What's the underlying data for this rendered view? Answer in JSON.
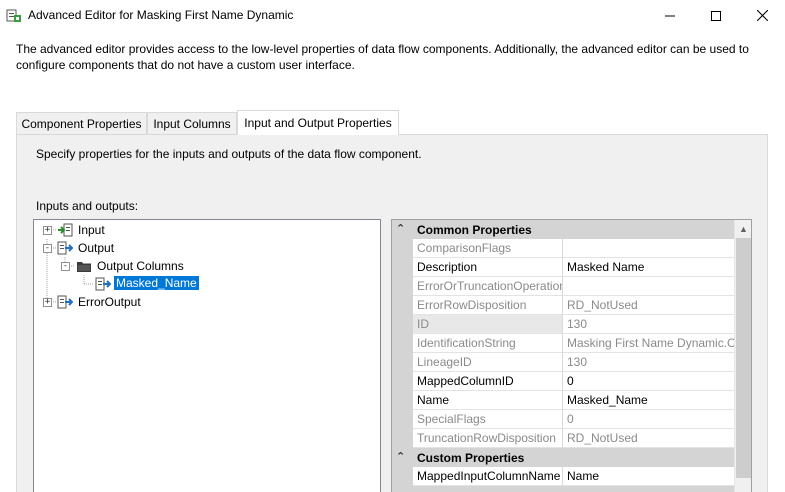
{
  "window": {
    "title": "Advanced Editor for Masking First Name Dynamic"
  },
  "description": "The advanced editor provides access to the low-level properties of data flow components. Additionally, the advanced editor can be used to configure components that do not have a custom user interface.",
  "tabs": [
    {
      "label": "Component Properties"
    },
    {
      "label": "Input Columns"
    },
    {
      "label": "Input and Output Properties",
      "active": true
    }
  ],
  "panel": {
    "description": "Specify properties for the inputs and outputs of the data flow component.",
    "io_label": "Inputs and outputs:"
  },
  "tree": {
    "items": [
      {
        "label": "Input",
        "expander": "+"
      },
      {
        "label": "Output",
        "expander": "-"
      },
      {
        "label": "Output Columns",
        "expander": "-"
      },
      {
        "label": "Masked_Name",
        "selected": true
      },
      {
        "label": "ErrorOutput",
        "expander": "+"
      }
    ]
  },
  "properties": {
    "common_category": "Common Properties",
    "custom_category": "Custom Properties",
    "rows": [
      {
        "name": "ComparisonFlags",
        "value": "",
        "readonly": true
      },
      {
        "name": "Description",
        "value": "Masked Name",
        "readonly": false
      },
      {
        "name": "ErrorOrTruncationOperation",
        "value": "",
        "readonly": true
      },
      {
        "name": "ErrorRowDisposition",
        "value": "RD_NotUsed",
        "readonly": true
      },
      {
        "name": "ID",
        "value": "130",
        "readonly": true
      },
      {
        "name": "IdentificationString",
        "value": "Masking First Name Dynamic.O",
        "readonly": true
      },
      {
        "name": "LineageID",
        "value": "130",
        "readonly": true
      },
      {
        "name": "MappedColumnID",
        "value": "0",
        "readonly": false
      },
      {
        "name": "Name",
        "value": "Masked_Name",
        "readonly": false
      },
      {
        "name": "SpecialFlags",
        "value": "0",
        "readonly": true
      },
      {
        "name": "TruncationRowDisposition",
        "value": "RD_NotUsed",
        "readonly": true
      }
    ],
    "custom_rows": [
      {
        "name": "MappedInputColumnName",
        "value": "Name",
        "readonly": false
      }
    ]
  }
}
